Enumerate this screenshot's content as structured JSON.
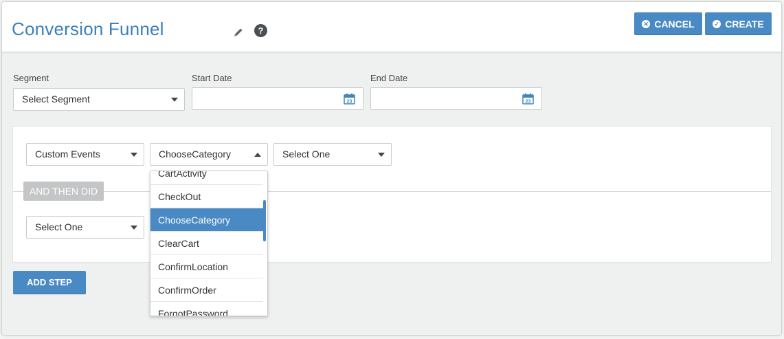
{
  "header": {
    "title": "Conversion Funnel",
    "cancel_label": "CANCEL",
    "create_label": "CREATE",
    "help_glyph": "?"
  },
  "filters": {
    "segment_label": "Segment",
    "segment_value": "Select Segment",
    "start_date_label": "Start Date",
    "start_date_value": "",
    "end_date_label": "End Date",
    "end_date_value": "",
    "calendar_day": "23"
  },
  "step1": {
    "event_type": "Custom Events",
    "event_name": "ChooseCategory",
    "property": "Select One"
  },
  "then_badge": "AND THEN DID",
  "step2": {
    "event_type": "Select One"
  },
  "add_step_label": "ADD STEP",
  "dropdown": {
    "items": [
      "CartActivity",
      "CheckOut",
      "ChooseCategory",
      "ClearCart",
      "ConfirmLocation",
      "ConfirmOrder",
      "ForgotPassword"
    ],
    "selected": "ChooseCategory"
  },
  "colors": {
    "accent": "#4a8ac4",
    "title": "#3b80b8"
  }
}
